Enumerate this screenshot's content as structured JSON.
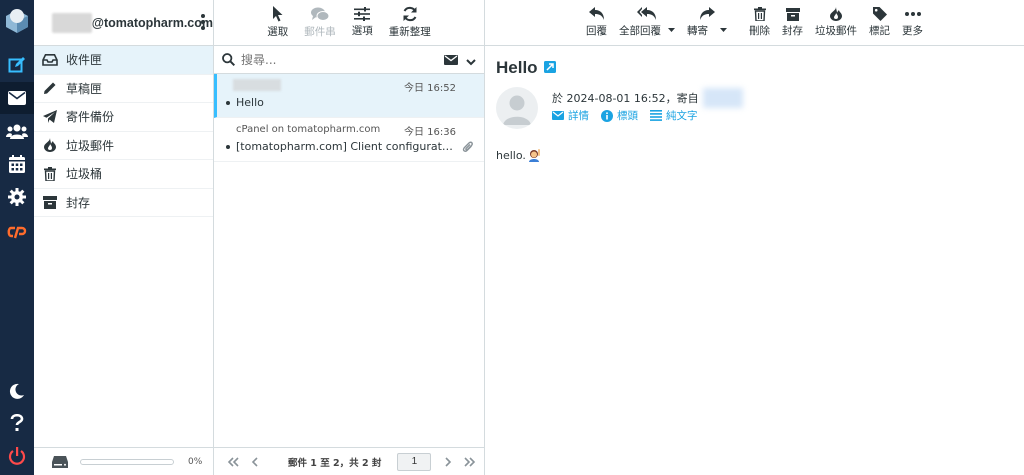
{
  "account": {
    "email_suffix": "@tomatopharm.com"
  },
  "folders": [
    {
      "label": "收件匣",
      "icon": "inbox-icon"
    },
    {
      "label": "草稿匣",
      "icon": "pencil-icon"
    },
    {
      "label": "寄件備份",
      "icon": "paper-plane-icon"
    },
    {
      "label": "垃圾郵件",
      "icon": "fire-icon"
    },
    {
      "label": "垃圾桶",
      "icon": "trash-icon"
    },
    {
      "label": "封存",
      "icon": "archive-icon"
    }
  ],
  "quota": {
    "percent_text": "0%",
    "fraction": 0
  },
  "list_toolbar": {
    "select": "選取",
    "threads": "郵件串",
    "options": "選項",
    "refresh": "重新整理"
  },
  "search": {
    "placeholder": "搜尋..."
  },
  "messages": [
    {
      "from": "",
      "date": "今日 16:52",
      "subject": "Hello",
      "attachment": false
    },
    {
      "from": "cPanel on tomatopharm.com",
      "date": "今日 16:36",
      "subject": "[tomatopharm.com] Client configuration settings",
      "attachment": true
    }
  ],
  "list_footer": {
    "count": "郵件 1 至 2，共 2 封",
    "page": "1"
  },
  "preview_toolbar": {
    "reply": "回覆",
    "reply_all": "全部回覆",
    "forward": "轉寄",
    "delete": "刪除",
    "archive": "封存",
    "junk": "垃圾郵件",
    "mark": "標記",
    "more": "更多"
  },
  "preview": {
    "subject": "Hello",
    "meta": "於 2024-08-01 16:52，寄自",
    "links": {
      "details": "詳情",
      "headers": "標頭",
      "plain": "純文字"
    },
    "body": "hello."
  },
  "colors": {
    "accent": "#37beff",
    "taskbar": "#172a44",
    "link": "#1aa3e2"
  }
}
